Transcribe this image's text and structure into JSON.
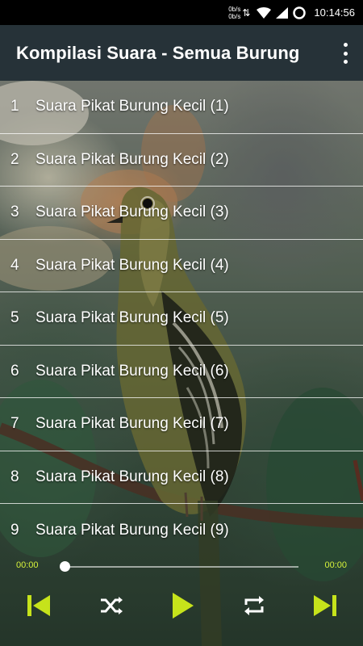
{
  "status_bar": {
    "net_up": "0b/s",
    "net_down": "0b/s",
    "time": "10:14:56"
  },
  "app_bar": {
    "title": "Kompilasi Suara - Semua Burung",
    "more_icon": "more-vert-icon"
  },
  "tracks": [
    {
      "num": "1",
      "title": "Suara Pikat Burung Kecil (1)"
    },
    {
      "num": "2",
      "title": "Suara Pikat Burung Kecil (2)"
    },
    {
      "num": "3",
      "title": "Suara Pikat Burung Kecil (3)"
    },
    {
      "num": "4",
      "title": "Suara Pikat Burung Kecil (4)"
    },
    {
      "num": "5",
      "title": "Suara Pikat Burung Kecil (5)"
    },
    {
      "num": "6",
      "title": "Suara Pikat Burung Kecil (6)"
    },
    {
      "num": "7",
      "title": "Suara Pikat Burung Kecil (7)"
    },
    {
      "num": "8",
      "title": "Suara Pikat Burung Kecil (8)"
    },
    {
      "num": "9",
      "title": "Suara Pikat Burung Kecil (9)"
    }
  ],
  "player": {
    "current_time": "00:00",
    "total_time": "00:00",
    "progress": 0,
    "accent": "#c6e31b",
    "controls": [
      "skip-previous-icon",
      "shuffle-icon",
      "play-icon",
      "repeat-icon",
      "skip-next-icon"
    ]
  }
}
